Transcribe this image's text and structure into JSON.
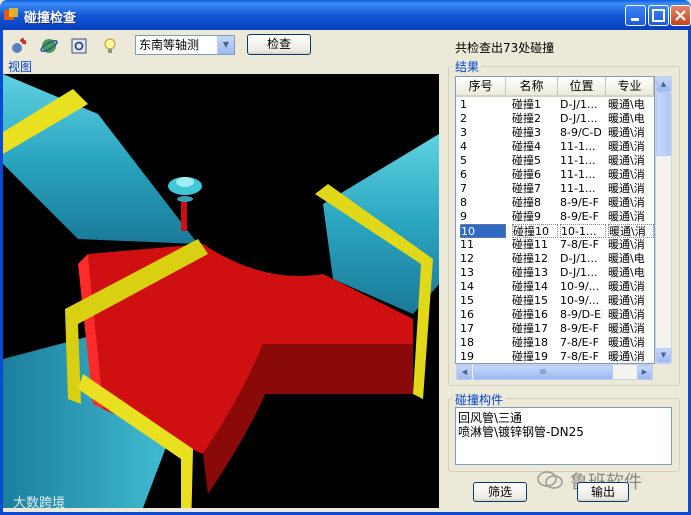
{
  "window": {
    "title": "碰撞检查"
  },
  "toolbar": {
    "icons": [
      "add-pin-icon",
      "rotate-globe-icon",
      "zoom-fit-icon",
      "lightbulb-icon"
    ],
    "view_select": "东南等轴测",
    "check_button": "检查"
  },
  "status": {
    "summary": "共检查出73处碰撞"
  },
  "view": {
    "label": "视图"
  },
  "results": {
    "label": "结果",
    "columns": [
      "序号",
      "名称",
      "位置",
      "专业"
    ],
    "rows": [
      [
        "1",
        "碰撞1",
        "D-J/1...",
        "暖通\\电"
      ],
      [
        "2",
        "碰撞2",
        "D-J/1...",
        "暖通\\电"
      ],
      [
        "3",
        "碰撞3",
        "8-9/C-D",
        "暖通\\消"
      ],
      [
        "4",
        "碰撞4",
        "11-1...",
        "暖通\\消"
      ],
      [
        "5",
        "碰撞5",
        "11-1...",
        "暖通\\消"
      ],
      [
        "6",
        "碰撞6",
        "11-1...",
        "暖通\\消"
      ],
      [
        "7",
        "碰撞7",
        "11-1...",
        "暖通\\消"
      ],
      [
        "8",
        "碰撞8",
        "8-9/E-F",
        "暖通\\消"
      ],
      [
        "9",
        "碰撞9",
        "8-9/E-F",
        "暖通\\消"
      ],
      [
        "10",
        "碰撞10",
        "10-1...",
        "暖通\\消"
      ],
      [
        "11",
        "碰撞11",
        "7-8/E-F",
        "暖通\\消"
      ],
      [
        "12",
        "碰撞12",
        "D-J/1...",
        "暖通\\电"
      ],
      [
        "13",
        "碰撞13",
        "D-J/1...",
        "暖通\\电"
      ],
      [
        "14",
        "碰撞14",
        "10-9/...",
        "暖通\\消"
      ],
      [
        "15",
        "碰撞15",
        "10-9/...",
        "暖通\\消"
      ],
      [
        "16",
        "碰撞16",
        "8-9/D-E",
        "暖通\\消"
      ],
      [
        "17",
        "碰撞17",
        "8-9/E-F",
        "暖通\\消"
      ],
      [
        "18",
        "碰撞18",
        "7-8/E-F",
        "暖通\\消"
      ],
      [
        "19",
        "碰撞19",
        "7-8/E-F",
        "暖通\\消"
      ]
    ],
    "selected_index": 9
  },
  "components": {
    "label": "碰撞构件",
    "lines": [
      "回风管\\三通",
      "喷淋管\\镀锌钢管-DN25"
    ]
  },
  "buttons": {
    "filter": "筛选",
    "export": "输出"
  },
  "watermarks": {
    "left": "大数跨境",
    "right": "鲁班软件"
  }
}
